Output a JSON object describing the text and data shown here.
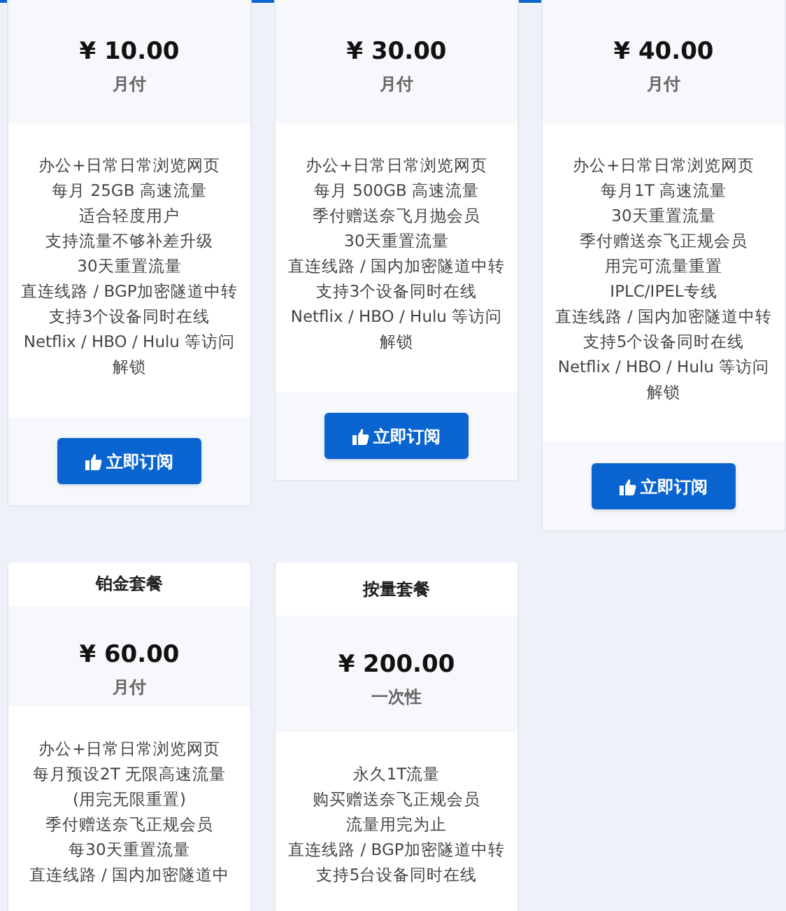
{
  "plans": [
    {
      "price": "¥ 10.00",
      "period": "月付",
      "features": [
        "办公+日常日常浏览网页",
        "每月 25GB 高速流量",
        "适合轻度用户",
        "支持流量不够补差升级",
        "30天重置流量",
        "直连线路 / BGP加密隧道中转",
        "支持3个设备同时在线",
        "Netflix / HBO / Hulu 等访问解锁"
      ],
      "button": "立即订阅"
    },
    {
      "price": "¥ 30.00",
      "period": "月付",
      "features": [
        "办公+日常日常浏览网页",
        "每月 500GB 高速流量",
        "季付赠送奈飞月抛会员",
        "30天重置流量",
        "直连线路 / 国内加密隧道中转",
        "支持3个设备同时在线",
        "Netflix / HBO / Hulu 等访问解锁"
      ],
      "button": "立即订阅"
    },
    {
      "price": "¥ 40.00",
      "period": "月付",
      "features": [
        "办公+日常日常浏览网页",
        "每月1T 高速流量",
        "30天重置流量",
        "季付赠送奈飞正规会员",
        "用完可流量重置",
        "IPLC/IPEL专线",
        "直连线路 / 国内加密隧道中转",
        "支持5个设备同时在线",
        "Netflix / HBO / Hulu 等访问解锁"
      ],
      "button": "立即订阅"
    },
    {
      "title": "铂金套餐",
      "price": "¥ 60.00",
      "period": "月付",
      "features": [
        "办公+日常日常浏览网页",
        "每月预设2T 无限高速流量",
        "(用完无限重置)",
        "季付赠送奈飞正规会员",
        "每30天重置流量",
        "直连线路 / 国内加密隧道中"
      ]
    },
    {
      "title": "按量套餐",
      "price": "¥ 200.00",
      "period": "一次性",
      "features": [
        "永久1T流量",
        "购买赠送奈飞正规会员",
        "流量用完为止",
        "直连线路 / BGP加密隧道中转",
        "支持5台设备同时在线"
      ]
    }
  ]
}
